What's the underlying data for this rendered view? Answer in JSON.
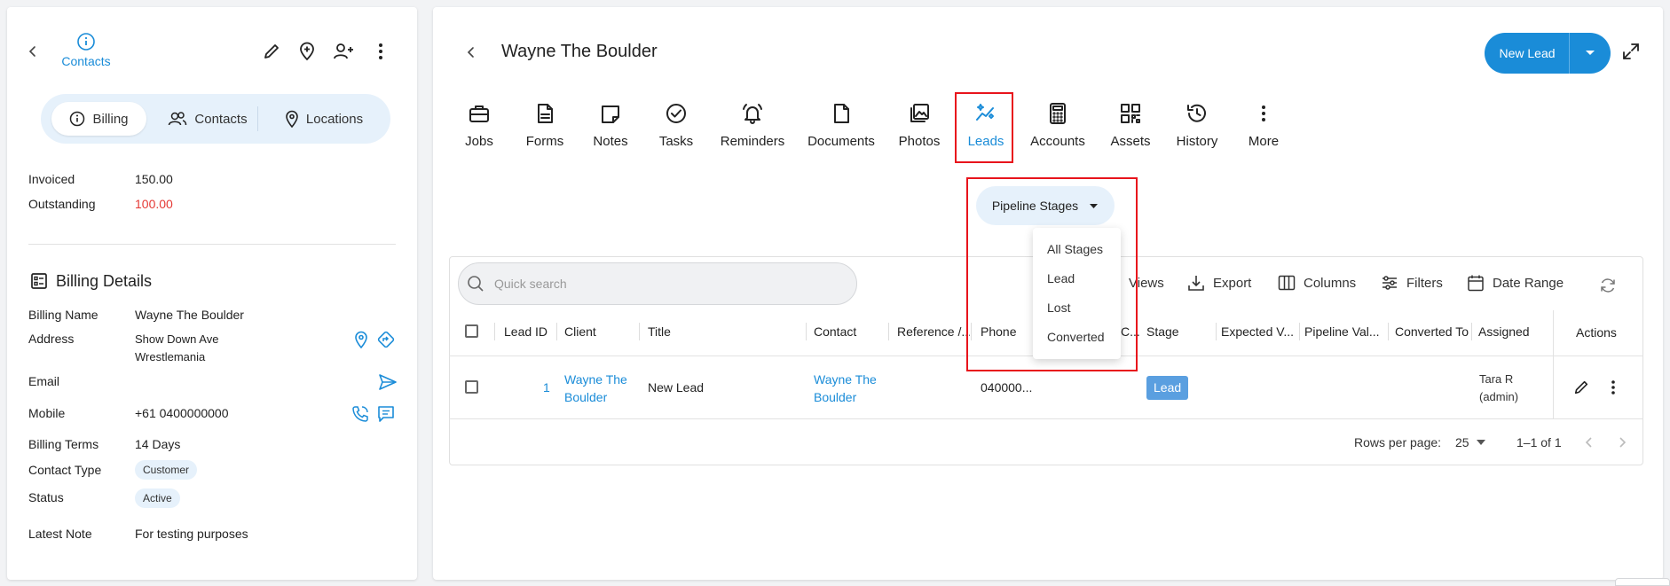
{
  "left": {
    "contacts_link": "Contacts",
    "segments": [
      "Billing",
      "Contacts",
      "Locations"
    ],
    "summary": [
      {
        "label": "Invoiced",
        "value": "150.00"
      },
      {
        "label": "Outstanding",
        "value": "100.00"
      }
    ],
    "billing_title": "Billing Details",
    "details": {
      "billing_name": {
        "label": "Billing Name",
        "value": "Wayne The Boulder"
      },
      "address": {
        "label": "Address",
        "line1": "Show Down Ave",
        "line2": "Wrestlemania"
      },
      "email": {
        "label": "Email",
        "value": ""
      },
      "mobile": {
        "label": "Mobile",
        "value": "+61 0400000000"
      },
      "billing_terms": {
        "label": "Billing Terms",
        "value": "14 Days"
      },
      "contact_type": {
        "label": "Contact Type",
        "value": "Customer"
      },
      "status": {
        "label": "Status",
        "value": "Active"
      },
      "latest_note": {
        "label": "Latest Note",
        "value": "For testing purposes"
      }
    }
  },
  "main": {
    "title": "Wayne The Boulder",
    "new_lead_label": "New Lead",
    "tabs": [
      "Jobs",
      "Forms",
      "Notes",
      "Tasks",
      "Reminders",
      "Documents",
      "Photos",
      "Leads",
      "Accounts",
      "Assets",
      "History",
      "More"
    ],
    "active_tab": "Leads",
    "pipeline_label": "Pipeline Stages",
    "pipeline_options": [
      "All Stages",
      "Lead",
      "Lost",
      "Converted"
    ],
    "search_placeholder": "Quick search",
    "toolbar": {
      "views": "Views",
      "export": "Export",
      "columns": "Columns",
      "filters": "Filters",
      "date_range": "Date Range"
    },
    "columns": [
      "Lead ID",
      "Client",
      "Title",
      "Contact",
      "Reference /...",
      "Phone",
      "C...",
      "Stage",
      "Expected V...",
      "Pipeline Val...",
      "Converted To",
      "Assigned",
      "Actions"
    ],
    "rows": [
      {
        "lead_id": "1",
        "client_line1": "Wayne The",
        "client_line2": "Boulder",
        "title": "New Lead",
        "contact_line1": "Wayne The",
        "contact_line2": "Boulder",
        "phone": "040000...",
        "stage": "Lead",
        "assigned_line1": "Tara R",
        "assigned_line2": "(admin)"
      }
    ],
    "pagination": {
      "rows_label": "Rows per page:",
      "rows_value": "25",
      "range": "1–1 of 1"
    }
  },
  "colors": {
    "accent": "#1a8cd8",
    "outstanding": "#e53935",
    "highlight": "#e8141c",
    "stage_badge": "#5a9fe0"
  }
}
